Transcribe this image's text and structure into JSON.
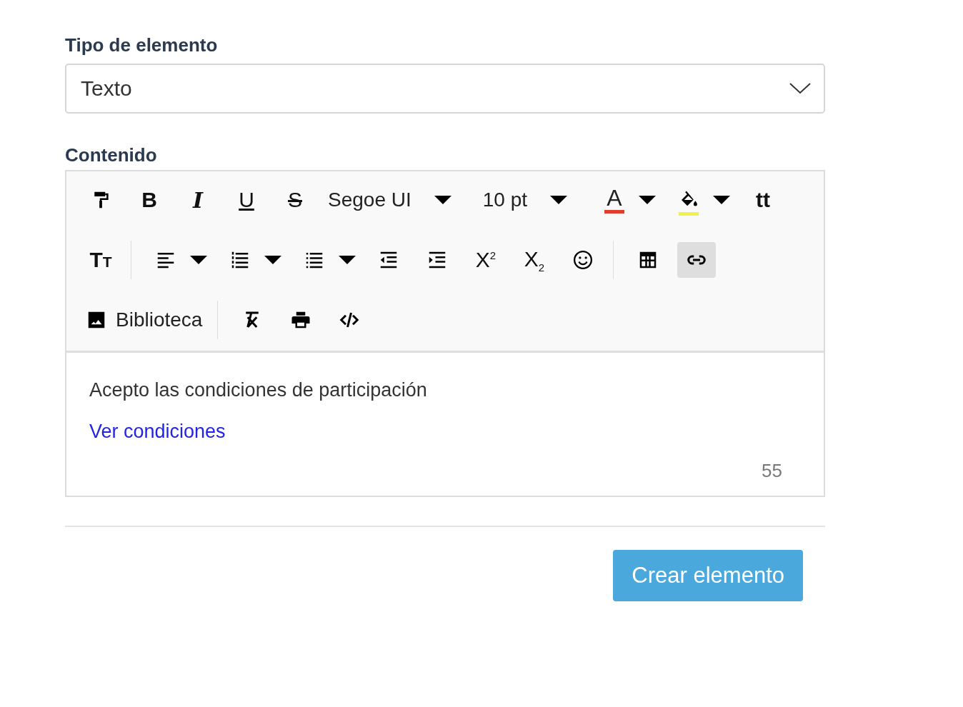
{
  "element_type": {
    "label": "Tipo de elemento",
    "value": "Texto"
  },
  "content": {
    "label": "Contenido",
    "toolbar": [
      [
        {
          "kind": "button",
          "selected": false
        },
        {
          "kind": "bold",
          "label": "B",
          "selected": false
        },
        {
          "kind": "italic",
          "label": "I",
          "selected": false
        },
        {
          "kind": "underline",
          "label": "U",
          "selected": false
        },
        {
          "kind": "strikethrough",
          "label": "S",
          "selected": false
        },
        {
          "kind": "select",
          "label": "Segoe UI"
        },
        {
          "kind": "select",
          "label": "10 pt"
        },
        {
          "kind": "split",
          "label": "A",
          "color": "#e03e2d",
          "selected": false
        },
        {
          "kind": "split",
          "color": "#f1f14b",
          "selected": false
        },
        {
          "kind": "bold",
          "label": "tt",
          "selected": false
        }
      ],
      [
        {
          "kind": "smallcaps",
          "label": "Tt",
          "selected": false
        },
        {
          "kind": "separator"
        },
        {
          "kind": "split",
          "selected": false
        },
        {
          "kind": "split",
          "selected": false
        },
        {
          "kind": "split",
          "selected": false
        },
        {
          "kind": "button",
          "selected": false
        },
        {
          "kind": "button",
          "selected": false
        },
        {
          "kind": "button",
          "label": "X$^{2}$",
          "selected": false
        },
        {
          "kind": "button",
          "label": "X$_{2}$",
          "selected": false
        },
        {
          "kind": "button",
          "selected": false
        },
        {
          "kind": "separator"
        },
        {
          "kind": "button",
          "selected": false
        },
        {
          "kind": "button",
          "selected": true
        }
      ],
      [
        {
          "kind": "button",
          "label": "Biblioteca",
          "selected": false
        },
        {
          "kind": "separator"
        },
        {
          "kind": "button",
          "selected": false
        },
        {
          "kind": "button",
          "selected": false
        },
        {
          "kind": "button",
          "selected": false
        }
      ]
    ],
    "paragraphs": [
      {
        "kind": "text",
        "text": "Acepto las condiciones de participación"
      },
      {
        "kind": "link",
        "text": "Ver condiciones"
      }
    ],
    "counter": "55"
  },
  "submit": "Crear elemento"
}
